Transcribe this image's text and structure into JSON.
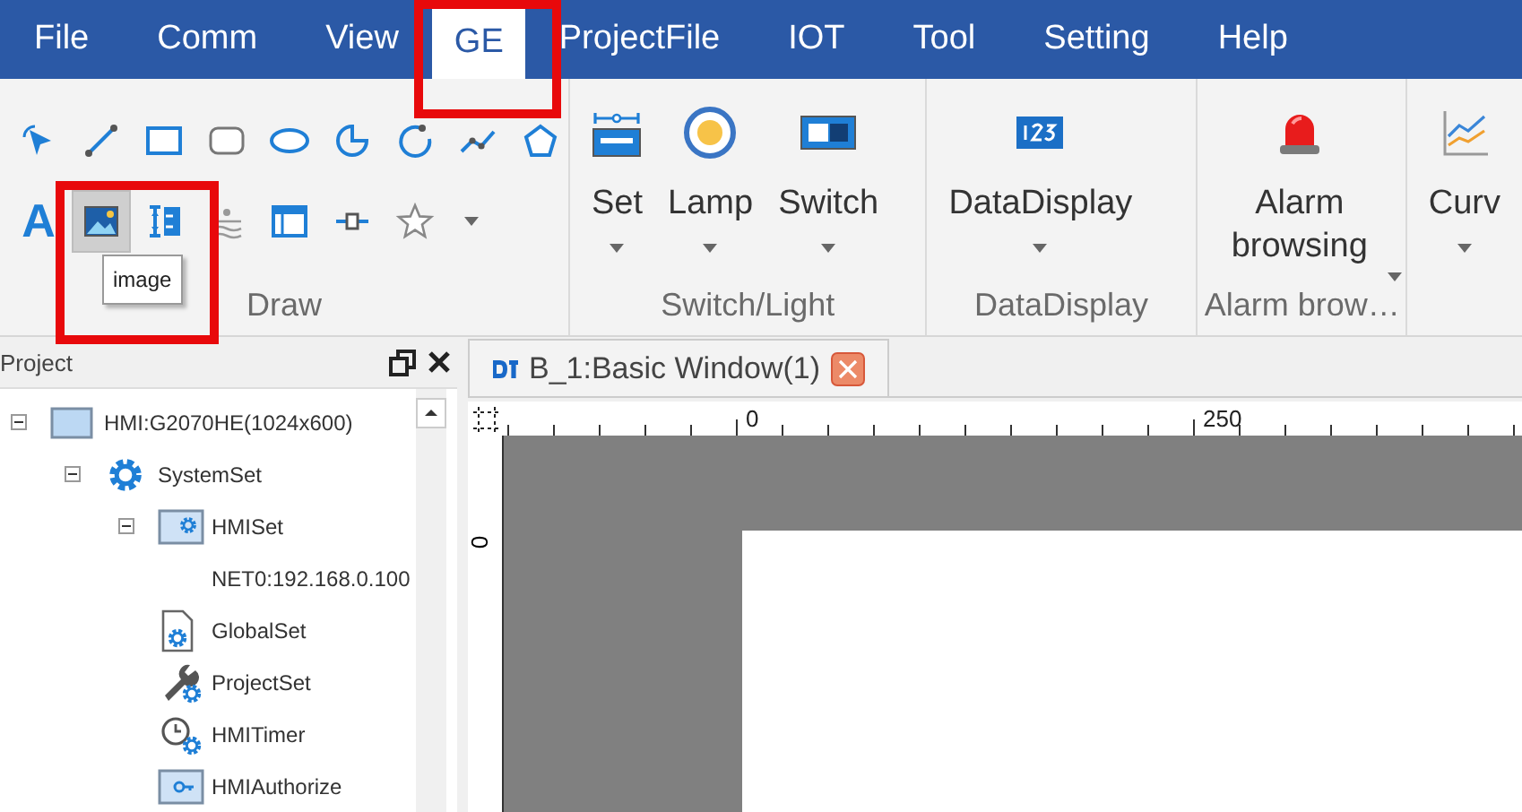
{
  "menu": [
    {
      "label": "File",
      "selected": false,
      "highlight": false
    },
    {
      "label": "Comm",
      "selected": false,
      "highlight": false
    },
    {
      "label": "View",
      "selected": false,
      "highlight": false
    },
    {
      "label": "GE",
      "selected": true,
      "highlight": true
    },
    {
      "label": "ProjectFile",
      "selected": false,
      "highlight": false
    },
    {
      "label": "IOT",
      "selected": false,
      "highlight": false
    },
    {
      "label": "Tool",
      "selected": false,
      "highlight": false
    },
    {
      "label": "Setting",
      "selected": false,
      "highlight": false
    },
    {
      "label": "Help",
      "selected": false,
      "highlight": false
    }
  ],
  "ribbon": {
    "groups": [
      {
        "label": "Draw",
        "kind": "tools",
        "rows": [
          [
            {
              "kind": "pointer",
              "selected": false
            },
            {
              "kind": "line",
              "selected": false
            },
            {
              "kind": "rect",
              "selected": false
            },
            {
              "kind": "roundrect",
              "selected": false
            },
            {
              "kind": "ellipse",
              "selected": false
            },
            {
              "kind": "pie",
              "selected": false
            },
            {
              "kind": "arc",
              "selected": false
            },
            {
              "kind": "polyline",
              "selected": false
            },
            {
              "kind": "pentagon",
              "selected": false
            }
          ],
          [
            {
              "kind": "text",
              "label": "A",
              "selected": false
            },
            {
              "kind": "image",
              "selected": true,
              "highlight": true,
              "tooltip": "image"
            },
            {
              "kind": "scale",
              "selected": false
            },
            {
              "kind": "level",
              "selected": false
            },
            {
              "kind": "table",
              "selected": false
            },
            {
              "kind": "slider",
              "selected": false
            },
            {
              "kind": "star",
              "selected": false
            },
            {
              "kind": "caret",
              "selected": false
            }
          ]
        ]
      },
      {
        "label": "Switch/Light",
        "kind": "buttons",
        "buttons": [
          {
            "label": "Set",
            "kind": "set",
            "dropdown": true
          },
          {
            "label": "Lamp",
            "kind": "lamp",
            "dropdown": true
          },
          {
            "label": "Switch",
            "kind": "switch",
            "dropdown": true
          }
        ]
      },
      {
        "label": "DataDisplay",
        "kind": "buttons",
        "buttons": [
          {
            "label": "DataDisplay",
            "kind": "number",
            "dropdown": true
          }
        ]
      },
      {
        "label": "Alarm brow…",
        "kind": "buttons",
        "buttons": [
          {
            "label": "Alarm browsing",
            "kind": "alarm",
            "dropdown": true
          }
        ]
      },
      {
        "kind": "buttons",
        "buttons": [
          {
            "label": "Curv",
            "kind": "curve",
            "dropdown": true
          }
        ]
      }
    ]
  },
  "project_panel": {
    "title": "Project",
    "tree": [
      {
        "label": "HMI:G2070HE(1024x600)",
        "kind": "screen",
        "expanded": true,
        "children": [
          {
            "label": "SystemSet",
            "kind": "gear",
            "expanded": true,
            "children": [
              {
                "label": "HMISet",
                "kind": "screen-gear",
                "expanded": true,
                "children": [
                  {
                    "label": "NET0:192.168.0.100"
                  }
                ]
              },
              {
                "label": "GlobalSet",
                "kind": "doc-gear"
              },
              {
                "label": "ProjectSet",
                "kind": "wrench-gear"
              },
              {
                "label": "HMITimer",
                "kind": "clock-gear"
              },
              {
                "label": "HMIAuthorize",
                "kind": "screen-key"
              }
            ]
          }
        ]
      }
    ]
  },
  "document_tabs": [
    {
      "label": "B_1:Basic Window(1)",
      "selected": true
    }
  ],
  "ruler": {
    "horizontal_labels": [
      "0",
      "250"
    ],
    "vertical_labels": [
      "0"
    ]
  }
}
